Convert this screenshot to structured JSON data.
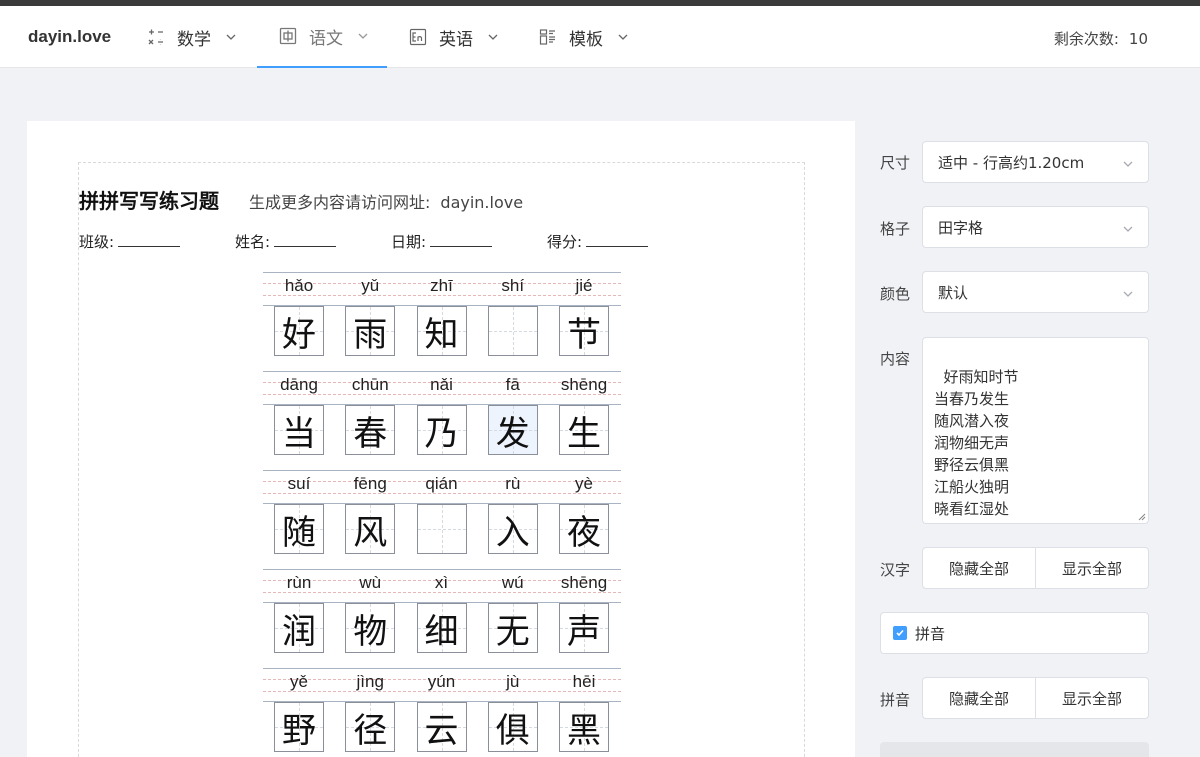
{
  "nav": {
    "brand": "dayin.love",
    "items": [
      {
        "label": "数学",
        "icon": "math-icon"
      },
      {
        "label": "语文",
        "icon": "chinese-icon"
      },
      {
        "label": "英语",
        "icon": "english-icon"
      },
      {
        "label": "模板",
        "icon": "template-icon"
      }
    ],
    "active_index": 1,
    "remain_label": "剩余次数:",
    "remain_value": "10"
  },
  "worksheet": {
    "title": "拼拼写写练习题",
    "subtitle": "生成更多内容请访问网址:",
    "url": "dayin.love",
    "fields": [
      "班级:",
      "姓名:",
      "日期:",
      "得分:"
    ],
    "rows": [
      [
        {
          "py": "hǎo",
          "hz": "好"
        },
        {
          "py": "yǔ",
          "hz": "雨"
        },
        {
          "py": "zhī",
          "hz": "知"
        },
        {
          "py": "shí",
          "hz": ""
        },
        {
          "py": "jié",
          "hz": "节"
        }
      ],
      [
        {
          "py": "dāng",
          "hz": "当"
        },
        {
          "py": "chūn",
          "hz": "春"
        },
        {
          "py": "nǎi",
          "hz": "乃"
        },
        {
          "py": "fā",
          "hz": "发"
        },
        {
          "py": "shēng",
          "hz": "生"
        }
      ],
      [
        {
          "py": "suí",
          "hz": "随"
        },
        {
          "py": "fēng",
          "hz": "风"
        },
        {
          "py": "qián",
          "hz": ""
        },
        {
          "py": "rù",
          "hz": "入"
        },
        {
          "py": "yè",
          "hz": "夜"
        }
      ],
      [
        {
          "py": "rùn",
          "hz": "润"
        },
        {
          "py": "wù",
          "hz": "物"
        },
        {
          "py": "xì",
          "hz": "细"
        },
        {
          "py": "wú",
          "hz": "无"
        },
        {
          "py": "shēng",
          "hz": "声"
        }
      ],
      [
        {
          "py": "yě",
          "hz": "野"
        },
        {
          "py": "jìng",
          "hz": "径"
        },
        {
          "py": "yún",
          "hz": "云"
        },
        {
          "py": "jù",
          "hz": "俱"
        },
        {
          "py": "hēi",
          "hz": "黑"
        }
      ]
    ]
  },
  "settings": {
    "size_label": "尺寸",
    "size_value": "适中 - 行高约1.20cm",
    "grid_label": "格子",
    "grid_value": "田字格",
    "color_label": "颜色",
    "color_value": "默认",
    "content_label": "内容",
    "content_value": "好雨知时节\n当春乃发生\n随风潜入夜\n润物细无声\n野径云俱黑\n江船火独明\n晓看红湿处\n花重锦官城",
    "hanzi_label": "汉字",
    "hide_all": "隐藏全部",
    "show_all": "显示全部",
    "pinyin_checkbox_label": "拼音",
    "pinyin_checked": true,
    "pinyin_label": "拼音"
  },
  "colors": {
    "accent": "#409eff",
    "highlight": "#eef4fd"
  }
}
